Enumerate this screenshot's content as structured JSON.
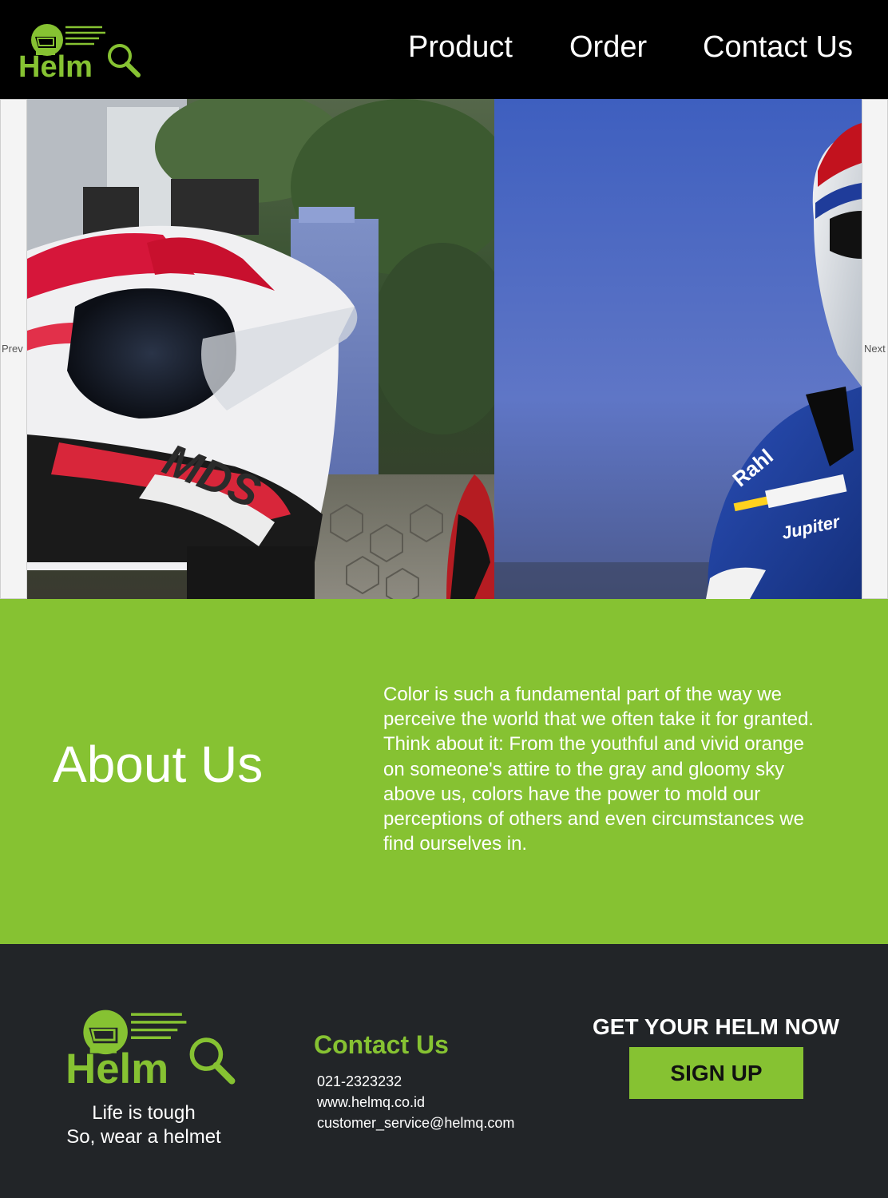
{
  "brand": {
    "logo_text": "Helm",
    "accent_color": "#86c232",
    "logo_icons": [
      "helmet-icon",
      "magnifier-icon"
    ]
  },
  "nav": {
    "items": [
      {
        "label": "Product"
      },
      {
        "label": "Order"
      },
      {
        "label": "Contact Us"
      }
    ]
  },
  "slider": {
    "prev_label": "Prev",
    "next_label": "Next",
    "slides": [
      {
        "subject": "red-white helmet in garden"
      },
      {
        "subject": "racer in blue suit and helmet against sky"
      }
    ]
  },
  "about": {
    "title": "About Us",
    "text": "Color is such a fundamental part of the way we perceive the world that we often take it for granted. Think about it: From the youthful and vivid orange on someone's attire to the gray and gloomy sky above us, colors have the power to mold our perceptions of others and even circumstances we find ourselves in."
  },
  "footer": {
    "tagline_1": "Life is tough",
    "tagline_2": "So, wear a helmet",
    "contact_title": "Contact Us",
    "phone": "021-2323232",
    "website": "www.helmq.co.id",
    "email": "customer_service@helmq.com",
    "cta_title": "GET YOUR HELM NOW",
    "signup_label": "SIGN UP"
  }
}
